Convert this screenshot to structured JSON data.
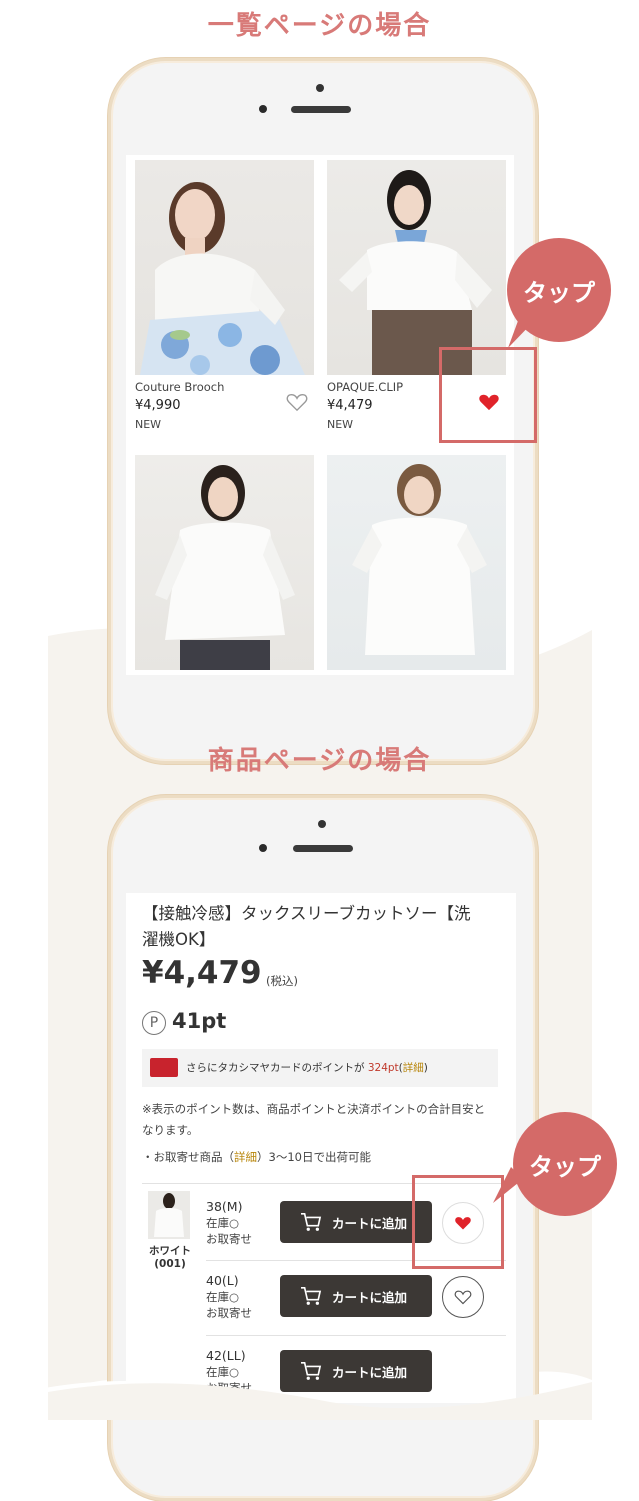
{
  "colors": {
    "accent": "#d46a68",
    "heading": "#d87a78",
    "band": "#f6f3ee",
    "frame": "#ecdcc3"
  },
  "section1": {
    "heading": "一覧ページの場合"
  },
  "section2": {
    "heading": "商品ページの場合"
  },
  "tap_label": "タップ",
  "list": {
    "products": [
      {
        "brand": "Couture Brooch",
        "price": "¥4,990",
        "tag": "NEW",
        "favorited": false
      },
      {
        "brand": "OPAQUE.CLIP",
        "price": "¥4,479",
        "tag": "NEW",
        "favorited": true
      }
    ]
  },
  "detail": {
    "title_line1": "【接触冷感】タックスリーブカットソー【洗",
    "title_line2": "濯機OK】",
    "price": "¥4,479",
    "tax_note": "(税込)",
    "points": "41pt",
    "point_icon": "P",
    "card_banner": {
      "prefix": "さらにタカシマヤカードのポイントが",
      "points": "324pt",
      "detail_open": "(",
      "detail_link": "詳細",
      "detail_close": ")"
    },
    "notice_line1": "※表示のポイント数は、商品ポイントと決済ポイントの合計目安と",
    "notice_line2": "なります。",
    "shipping": {
      "prefix": "・お取寄せ商品（",
      "link": "詳細",
      "suffix": "）3〜10日で出荷可能"
    },
    "color": {
      "name": "ホワイト",
      "code": "(001)"
    },
    "sizes": [
      {
        "size": "38(M)",
        "stock": "在庫○",
        "order": "お取寄せ",
        "favorited": true
      },
      {
        "size": "40(L)",
        "stock": "在庫○",
        "order": "お取寄せ",
        "favorited": false
      },
      {
        "size": "42(LL)",
        "stock": "在庫○",
        "order": "お取寄せ",
        "favorited": false
      }
    ],
    "cart_label": "カートに追加"
  }
}
